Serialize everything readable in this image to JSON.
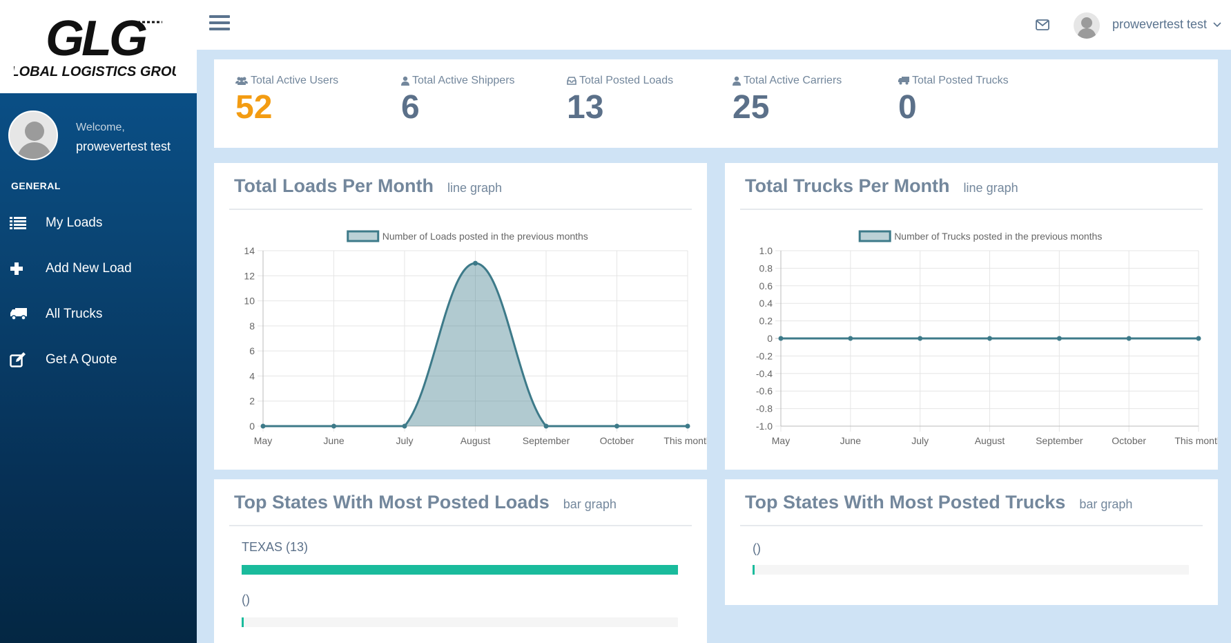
{
  "brand": {
    "logo_text": "GLG",
    "logo_subtext": "GLOBAL LOGISTICS GROUP"
  },
  "sidebar": {
    "welcome": "Welcome,",
    "username": "prowevertest test",
    "section": "GENERAL",
    "items": [
      {
        "label": "My Loads",
        "icon": "list-icon"
      },
      {
        "label": "Add New Load",
        "icon": "plus-icon"
      },
      {
        "label": "All Trucks",
        "icon": "truck-icon"
      },
      {
        "label": "Get A Quote",
        "icon": "edit-icon"
      }
    ]
  },
  "topbar": {
    "username": "prowevertest test"
  },
  "stats": [
    {
      "label": "Total Active Users",
      "value": "52",
      "icon": "users-icon"
    },
    {
      "label": "Total Active Shippers",
      "value": "6",
      "icon": "user-icon"
    },
    {
      "label": "Total Posted Loads",
      "value": "13",
      "icon": "inbox-icon"
    },
    {
      "label": "Total Active Carriers",
      "value": "25",
      "icon": "user-icon"
    },
    {
      "label": "Total Posted Trucks",
      "value": "0",
      "icon": "truck-icon"
    }
  ],
  "loads_panel": {
    "title": "Total Loads Per Month",
    "subtitle": "line graph"
  },
  "trucks_panel": {
    "title": "Total Trucks Per Month",
    "subtitle": "line graph"
  },
  "states_loads_panel": {
    "title": "Top States With Most Posted Loads",
    "subtitle": "bar graph",
    "bars": [
      {
        "label": "TEXAS (13)",
        "fraction": 1.0
      },
      {
        "label": "()",
        "fraction": 0.0
      }
    ]
  },
  "states_trucks_panel": {
    "title": "Top States With Most Posted Trucks",
    "subtitle": "bar graph",
    "bars": [
      {
        "label": "()",
        "fraction": 0.0
      }
    ]
  },
  "colors": {
    "accent": "#1abb9c",
    "line": "#3d7a89",
    "orange": "#f39c12"
  },
  "chart_data": [
    {
      "type": "area",
      "categories": [
        "May",
        "June",
        "July",
        "August",
        "September",
        "October",
        "This month"
      ],
      "series": [
        {
          "name": "Number of Loads posted in the previous months",
          "values": [
            0,
            0,
            0,
            13,
            0,
            0,
            0
          ]
        }
      ],
      "ylim": [
        0,
        14
      ],
      "yticks": [
        0,
        2,
        4,
        6,
        8,
        10,
        12,
        14
      ],
      "ytick_labels": [
        "0",
        "2",
        "4",
        "6",
        "8",
        "10",
        "12",
        "14"
      ],
      "legend": "top-center",
      "grid": true
    },
    {
      "type": "line",
      "categories": [
        "May",
        "June",
        "July",
        "August",
        "September",
        "October",
        "This month"
      ],
      "series": [
        {
          "name": "Number of Trucks posted in the previous months",
          "values": [
            0,
            0,
            0,
            0,
            0,
            0,
            0
          ]
        }
      ],
      "ylim": [
        -1.0,
        1.0
      ],
      "yticks": [
        1.0,
        0.8,
        0.6,
        0.4,
        0.2,
        0,
        -0.2,
        -0.4,
        -0.6,
        -0.8,
        -1.0
      ],
      "ytick_labels": [
        "1.0",
        "0.8",
        "0.6",
        "0.4",
        "0.2",
        "0",
        "-0.2",
        "-0.4",
        "-0.6",
        "-0.8",
        "-1.0"
      ],
      "legend": "top-center",
      "grid": true
    }
  ]
}
